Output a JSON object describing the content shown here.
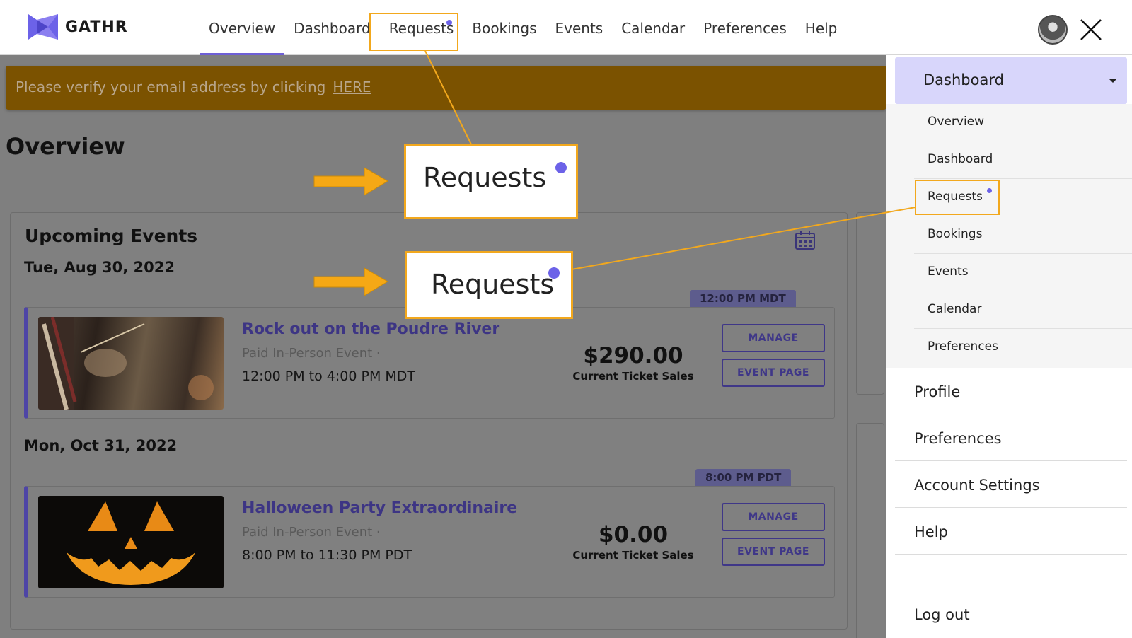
{
  "header": {
    "logo_text": "GATHR",
    "nav": [
      {
        "label": "Overview"
      },
      {
        "label": "Dashboard"
      },
      {
        "label": "Requests"
      },
      {
        "label": "Bookings"
      },
      {
        "label": "Events"
      },
      {
        "label": "Calendar"
      },
      {
        "label": "Preferences"
      },
      {
        "label": "Help"
      }
    ],
    "active_nav": "Overview",
    "close_icon": "close-icon"
  },
  "banner": {
    "text": "Please verify your email address by clicking",
    "link": "HERE",
    "color": "#7b5200"
  },
  "page": {
    "title": "Overview"
  },
  "upcoming": {
    "title": "Upcoming Events",
    "groups": [
      {
        "date": "Tue, Aug 30, 2022",
        "badge": "12:00 PM MDT",
        "event": {
          "title": "Rock out on the Poudre River",
          "type": "Paid In-Person Event ·",
          "time": "12:00 PM to 4:00 PM MDT",
          "price": "$290.00",
          "price_label": "Current Ticket Sales",
          "manage": "MANAGE",
          "event_page": "EVENT PAGE"
        }
      },
      {
        "date": "Mon, Oct 31, 2022",
        "badge": "8:00 PM PDT",
        "event": {
          "title": "Halloween Party Extraordinaire",
          "type": "Paid In-Person Event ·",
          "time": "8:00 PM to 11:30 PM PDT",
          "price": "$0.00",
          "price_label": "Current Ticket Sales",
          "manage": "MANAGE",
          "event_page": "EVENT PAGE"
        }
      }
    ]
  },
  "menu": {
    "head": "Dashboard",
    "sub_items": [
      {
        "label": "Overview"
      },
      {
        "label": "Dashboard"
      },
      {
        "label": "Requests"
      },
      {
        "label": "Bookings"
      },
      {
        "label": "Events"
      },
      {
        "label": "Calendar"
      },
      {
        "label": "Preferences"
      }
    ],
    "items": [
      {
        "label": "Profile"
      },
      {
        "label": "Preferences"
      },
      {
        "label": "Account Settings"
      },
      {
        "label": "Help"
      },
      {
        "label": "Log out"
      }
    ]
  },
  "callouts": [
    {
      "label": "Requests"
    },
    {
      "label": "Requests"
    }
  ],
  "colors": {
    "accent": "#6c62e8",
    "highlight": "#f2a81d",
    "event_title": "#3d3584"
  }
}
